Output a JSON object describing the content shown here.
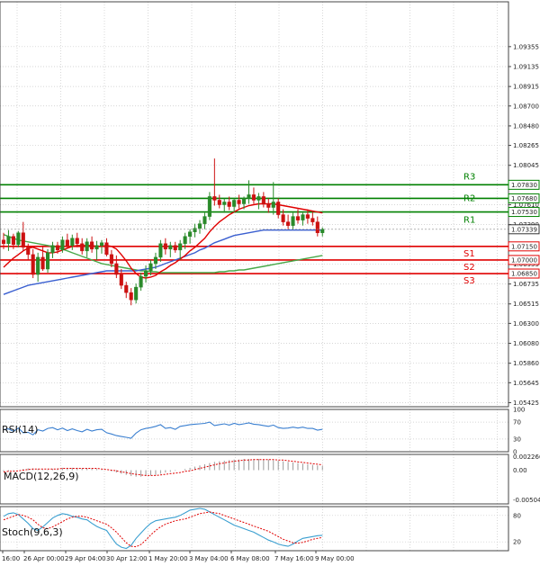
{
  "chart_data": {
    "type": "candlestick",
    "symbol_note": "",
    "price_axis": {
      "ylim": [
        1.0538,
        1.0985
      ],
      "ticks": [
        "1.09355",
        "1.09135",
        "1.08915",
        "1.08700",
        "1.08480",
        "1.08265",
        "1.08045",
        "1.07830",
        "1.07610",
        "1.07390",
        "1.06955",
        "1.06735",
        "1.06515",
        "1.06300",
        "1.06080",
        "1.05860",
        "1.05645",
        "1.05425"
      ],
      "current_price": "1.07339"
    },
    "time_axis": {
      "labels": [
        "16:00",
        "26 Apr 00:00",
        "29 Apr 04:00",
        "30 Apr 12:00",
        "1 May 20:00",
        "3 May 04:00",
        "6 May 08:00",
        "7 May 16:00",
        "9 May 00:00"
      ]
    },
    "levels": [
      {
        "name": "R3",
        "value": 1.0783,
        "label": "1.07830",
        "color": "#008000"
      },
      {
        "name": "R2",
        "value": 1.0768,
        "label": "1.07680",
        "color": "#008000"
      },
      {
        "name": "R1",
        "value": 1.0753,
        "label": "1.07530",
        "color": "#008000"
      },
      {
        "name": "S1",
        "value": 1.0715,
        "label": "1.07150",
        "color": "#e00000"
      },
      {
        "name": "S2",
        "value": 1.07,
        "label": "1.07000",
        "color": "#e00000"
      },
      {
        "name": "S3",
        "value": 1.0685,
        "label": "1.06850",
        "color": "#e00000"
      }
    ],
    "colors": {
      "bull": "#2a8a2a",
      "bear": "#cc1111",
      "ma_red": "#e00000",
      "ma_blue": "#3a5fd0",
      "ma_green": "#48a848",
      "rsi": "#3a7fd0",
      "macd_hist": "#9a9a9a",
      "macd_signal": "#e00000",
      "stoch_main": "#3a9fd0",
      "stoch_signal": "#e00000"
    },
    "candles": [
      [
        1.0722,
        1.073,
        1.0712,
        1.0718
      ],
      [
        1.0718,
        1.0733,
        1.071,
        1.0726
      ],
      [
        1.0726,
        1.0729,
        1.0712,
        1.0717
      ],
      [
        1.0717,
        1.0732,
        1.0714,
        1.073
      ],
      [
        1.073,
        1.0742,
        1.071,
        1.0714
      ],
      [
        1.0714,
        1.0718,
        1.07,
        1.0706
      ],
      [
        1.0706,
        1.0712,
        1.068,
        1.0684
      ],
      [
        1.0684,
        1.0708,
        1.0676,
        1.0703
      ],
      [
        1.0703,
        1.0715,
        1.0688,
        1.069
      ],
      [
        1.069,
        1.0712,
        1.0686,
        1.0708
      ],
      [
        1.0708,
        1.072,
        1.0702,
        1.0716
      ],
      [
        1.0716,
        1.072,
        1.0707,
        1.0711
      ],
      [
        1.0711,
        1.0726,
        1.0708,
        1.0722
      ],
      [
        1.0722,
        1.0729,
        1.0713,
        1.0716
      ],
      [
        1.0716,
        1.0728,
        1.0711,
        1.0724
      ],
      [
        1.0724,
        1.073,
        1.0714,
        1.0718
      ],
      [
        1.0718,
        1.0724,
        1.0706,
        1.071
      ],
      [
        1.071,
        1.0724,
        1.0703,
        1.072
      ],
      [
        1.072,
        1.0726,
        1.0708,
        1.0712
      ],
      [
        1.0712,
        1.0721,
        1.07,
        1.0716
      ],
      [
        1.0716,
        1.0722,
        1.0707,
        1.0719
      ],
      [
        1.0719,
        1.0724,
        1.0704,
        1.0706
      ],
      [
        1.0706,
        1.0711,
        1.0692,
        1.0696
      ],
      [
        1.0696,
        1.0705,
        1.068,
        1.0684
      ],
      [
        1.0684,
        1.069,
        1.0668,
        1.0672
      ],
      [
        1.0672,
        1.0676,
        1.0658,
        1.0664
      ],
      [
        1.0664,
        1.0669,
        1.065,
        1.0656
      ],
      [
        1.0656,
        1.0674,
        1.0652,
        1.067
      ],
      [
        1.067,
        1.0686,
        1.0666,
        1.0682
      ],
      [
        1.0682,
        1.0694,
        1.0675,
        1.0688
      ],
      [
        1.0688,
        1.07,
        1.0683,
        1.0696
      ],
      [
        1.0696,
        1.0708,
        1.069,
        1.0703
      ],
      [
        1.0703,
        1.0722,
        1.0698,
        1.0718
      ],
      [
        1.0718,
        1.0724,
        1.0706,
        1.0712
      ],
      [
        1.0712,
        1.072,
        1.0703,
        1.0716
      ],
      [
        1.0716,
        1.072,
        1.0708,
        1.0711
      ],
      [
        1.0711,
        1.0722,
        1.07,
        1.0718
      ],
      [
        1.0718,
        1.073,
        1.0712,
        1.0726
      ],
      [
        1.0726,
        1.0734,
        1.0718,
        1.0731
      ],
      [
        1.0731,
        1.074,
        1.0725,
        1.0735
      ],
      [
        1.0735,
        1.0744,
        1.0729,
        1.074
      ],
      [
        1.074,
        1.0752,
        1.0734,
        1.0748
      ],
      [
        1.0748,
        1.0775,
        1.0744,
        1.077
      ],
      [
        1.077,
        1.0812,
        1.076,
        1.0766
      ],
      [
        1.0766,
        1.0772,
        1.0757,
        1.0761
      ],
      [
        1.0761,
        1.0768,
        1.0752,
        1.0764
      ],
      [
        1.0764,
        1.077,
        1.0755,
        1.0759
      ],
      [
        1.0759,
        1.0768,
        1.0752,
        1.0766
      ],
      [
        1.0766,
        1.0772,
        1.0757,
        1.0762
      ],
      [
        1.0762,
        1.077,
        1.0756,
        1.0768
      ],
      [
        1.0768,
        1.0788,
        1.0762,
        1.0772
      ],
      [
        1.0772,
        1.078,
        1.0762,
        1.0766
      ],
      [
        1.0766,
        1.0774,
        1.0756,
        1.077
      ],
      [
        1.077,
        1.0775,
        1.0758,
        1.0762
      ],
      [
        1.0762,
        1.0768,
        1.0752,
        1.0758
      ],
      [
        1.0758,
        1.0786,
        1.075,
        1.0764
      ],
      [
        1.0764,
        1.0768,
        1.0746,
        1.075
      ],
      [
        1.075,
        1.0756,
        1.0738,
        1.0742
      ],
      [
        1.0742,
        1.075,
        1.0734,
        1.0738
      ],
      [
        1.0738,
        1.0752,
        1.0734,
        1.0748
      ],
      [
        1.0748,
        1.0756,
        1.074,
        1.0744
      ],
      [
        1.0744,
        1.0752,
        1.0738,
        1.075
      ],
      [
        1.075,
        1.0756,
        1.074,
        1.0746
      ],
      [
        1.0746,
        1.0753,
        1.0738,
        1.0742
      ],
      [
        1.0742,
        1.0748,
        1.0726,
        1.073
      ],
      [
        1.073,
        1.0736,
        1.0726,
        1.0734
      ]
    ],
    "ma_red": [
      1.0692,
      1.0697,
      1.0702,
      1.0706,
      1.071,
      1.0713,
      1.0714,
      1.0712,
      1.071,
      1.0708,
      1.0708,
      1.0709,
      1.0711,
      1.0713,
      1.0715,
      1.0716,
      1.0716,
      1.0716,
      1.0716,
      1.0715,
      1.0715,
      1.0716,
      1.0715,
      1.0712,
      1.0706,
      1.0699,
      1.0691,
      1.0685,
      1.0681,
      1.068,
      1.0681,
      1.0683,
      1.0687,
      1.069,
      1.0694,
      1.0697,
      1.0701,
      1.0705,
      1.071,
      1.0714,
      1.0719,
      1.0724,
      1.0731,
      1.0737,
      1.0742,
      1.0746,
      1.075,
      1.0753,
      1.0756,
      1.0758,
      1.076,
      1.0761,
      1.0762,
      1.0762,
      1.0762,
      1.0762,
      1.0761,
      1.076,
      1.0759,
      1.0758,
      1.0757,
      1.0756,
      1.0755,
      1.0754,
      1.0753,
      1.0752
    ],
    "ma_blue": [
      1.0662,
      1.0664,
      1.0666,
      1.0668,
      1.067,
      1.0672,
      1.0673,
      1.0674,
      1.0675,
      1.0676,
      1.0677,
      1.0678,
      1.0679,
      1.068,
      1.0681,
      1.0682,
      1.0683,
      1.0684,
      1.0685,
      1.0686,
      1.0687,
      1.0688,
      1.0688,
      1.0688,
      1.0688,
      1.0688,
      1.0688,
      1.0688,
      1.0689,
      1.069,
      1.0691,
      1.0692,
      1.0694,
      1.0696,
      1.0698,
      1.07,
      1.0702,
      1.0704,
      1.0706,
      1.0708,
      1.0711,
      1.0713,
      1.0716,
      1.0719,
      1.0721,
      1.0723,
      1.0725,
      1.0727,
      1.0728,
      1.0729,
      1.073,
      1.0731,
      1.0732,
      1.0733,
      1.0733,
      1.0733,
      1.0733,
      1.0733,
      1.0733,
      1.0733,
      1.0733,
      1.0733,
      1.0733,
      1.0733,
      1.0733,
      1.0733
    ],
    "ma_green": [
      1.0728,
      1.0726,
      1.0724,
      1.0722,
      1.0721,
      1.072,
      1.0719,
      1.0718,
      1.0717,
      1.0716,
      1.0715,
      1.0714,
      1.0712,
      1.071,
      1.0708,
      1.0706,
      1.0704,
      1.0702,
      1.07,
      1.0698,
      1.0696,
      1.0695,
      1.0694,
      1.0693,
      1.0692,
      1.0691,
      1.069,
      1.0689,
      1.0688,
      1.0688,
      1.0687,
      1.0687,
      1.0686,
      1.0686,
      1.0686,
      1.0686,
      1.0686,
      1.0686,
      1.0686,
      1.0686,
      1.0686,
      1.0686,
      1.0686,
      1.0686,
      1.0687,
      1.0687,
      1.0688,
      1.0688,
      1.0689,
      1.0689,
      1.069,
      1.0691,
      1.0692,
      1.0693,
      1.0694,
      1.0695,
      1.0696,
      1.0697,
      1.0698,
      1.0699,
      1.07,
      1.0701,
      1.0702,
      1.0703,
      1.0704,
      1.0705
    ],
    "rsi": {
      "label": "RSI(14)",
      "ylim": [
        0,
        100
      ],
      "ticks": [
        "100",
        "70",
        "30",
        "0"
      ],
      "values": [
        52,
        54,
        48,
        56,
        45,
        46,
        40,
        52,
        49,
        55,
        57,
        52,
        56,
        50,
        54,
        50,
        47,
        53,
        49,
        52,
        53,
        45,
        42,
        38,
        36,
        34,
        32,
        44,
        52,
        55,
        57,
        60,
        64,
        55,
        57,
        53,
        60,
        62,
        64,
        65,
        66,
        67,
        70,
        62,
        64,
        66,
        63,
        67,
        64,
        66,
        68,
        65,
        64,
        62,
        60,
        63,
        57,
        55,
        56,
        58,
        56,
        58,
        55,
        55,
        51,
        53
      ]
    },
    "macd": {
      "label": "MACD(12,26,9)",
      "ylim": [
        -0.0057,
        0.00266
      ],
      "ticks": [
        "0.002266",
        "0.00",
        "-0.005046"
      ],
      "hist": [
        -0.0002,
        -0.0002,
        -0.0001,
        0.0,
        0.0002,
        0.0003,
        0.0003,
        0.0002,
        0.0001,
        0.0001,
        0.0002,
        0.0003,
        0.0004,
        0.0004,
        0.0004,
        0.0004,
        0.0003,
        0.0003,
        0.0003,
        0.0002,
        0.0001,
        0.0,
        -0.0002,
        -0.0004,
        -0.0006,
        -0.0008,
        -0.001,
        -0.0011,
        -0.0011,
        -0.001,
        -0.0009,
        -0.0008,
        -0.0006,
        -0.0004,
        -0.0003,
        -0.0001,
        0.0,
        0.0002,
        0.0004,
        0.0006,
        0.0008,
        0.001,
        0.0012,
        0.0014,
        0.0015,
        0.0016,
        0.0017,
        0.0018,
        0.0018,
        0.0019,
        0.0019,
        0.0019,
        0.0019,
        0.0018,
        0.0018,
        0.0017,
        0.0016,
        0.0015,
        0.0014,
        0.0013,
        0.0012,
        0.0011,
        0.001,
        0.0009,
        0.0008,
        0.0007
      ],
      "signal": [
        -0.0003,
        -0.0002,
        -0.0002,
        -0.0001,
        0.0,
        0.0001,
        0.0002,
        0.0002,
        0.0002,
        0.0002,
        0.0002,
        0.0002,
        0.0003,
        0.0003,
        0.0003,
        0.0003,
        0.0003,
        0.0003,
        0.0003,
        0.0003,
        0.0002,
        0.0001,
        0.0,
        -0.0001,
        -0.0003,
        -0.0004,
        -0.0006,
        -0.0007,
        -0.0008,
        -0.0009,
        -0.0009,
        -0.0009,
        -0.0008,
        -0.0007,
        -0.0006,
        -0.0005,
        -0.0004,
        -0.0002,
        -0.0001,
        0.0001,
        0.0003,
        0.0005,
        0.0007,
        0.0009,
        0.0011,
        0.0012,
        0.0014,
        0.0015,
        0.0016,
        0.0017,
        0.0017,
        0.0018,
        0.0018,
        0.0018,
        0.0018,
        0.0018,
        0.0017,
        0.0017,
        0.0016,
        0.0015,
        0.0014,
        0.0013,
        0.0012,
        0.0011,
        0.001,
        0.0009
      ]
    },
    "stoch": {
      "label": "Stoch(9,6,3)",
      "ylim": [
        0,
        100
      ],
      "ticks": [
        "80",
        "20"
      ],
      "main": [
        78,
        84,
        86,
        82,
        72,
        62,
        50,
        46,
        54,
        64,
        74,
        80,
        84,
        82,
        78,
        76,
        72,
        70,
        62,
        55,
        50,
        46,
        30,
        15,
        8,
        5,
        12,
        28,
        40,
        52,
        62,
        68,
        70,
        72,
        74,
        76,
        80,
        86,
        92,
        94,
        96,
        94,
        88,
        82,
        76,
        70,
        64,
        58,
        54,
        50,
        46,
        42,
        36,
        30,
        24,
        20,
        15,
        12,
        10,
        15,
        22,
        28,
        30,
        32,
        34,
        35
      ],
      "signal": [
        70,
        74,
        78,
        82,
        80,
        76,
        70,
        60,
        52,
        50,
        54,
        60,
        66,
        72,
        76,
        78,
        78,
        76,
        72,
        68,
        64,
        60,
        52,
        42,
        30,
        18,
        10,
        9,
        14,
        24,
        36,
        46,
        54,
        60,
        64,
        68,
        70,
        72,
        76,
        80,
        84,
        86,
        88,
        86,
        84,
        80,
        76,
        72,
        68,
        64,
        60,
        56,
        52,
        48,
        44,
        38,
        32,
        26,
        22,
        18,
        17,
        19,
        22,
        26,
        28,
        30
      ]
    }
  }
}
